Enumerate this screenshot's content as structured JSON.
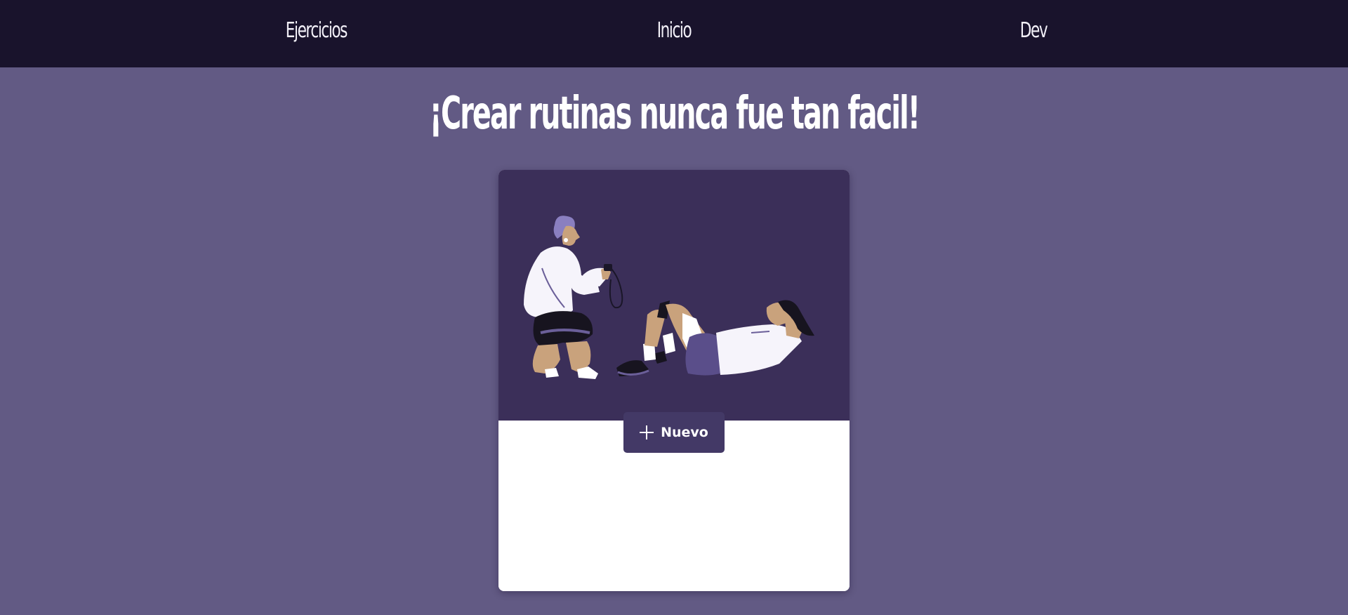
{
  "nav": {
    "items": [
      {
        "label": "Ejercicios"
      },
      {
        "label": "Inicio"
      },
      {
        "label": "Dev"
      }
    ]
  },
  "hero": {
    "title": "¡Crear rutinas nunca fue tan facil!"
  },
  "card": {
    "illustration_icon": "trainer-timing-situps-illustration",
    "new_button": {
      "label": "Nuevo",
      "icon": "plus-icon"
    }
  },
  "colors": {
    "page_background": "#625a84",
    "navbar_background": "#19132c",
    "card_image_background": "#3b2f59",
    "button_background": "#433966"
  }
}
